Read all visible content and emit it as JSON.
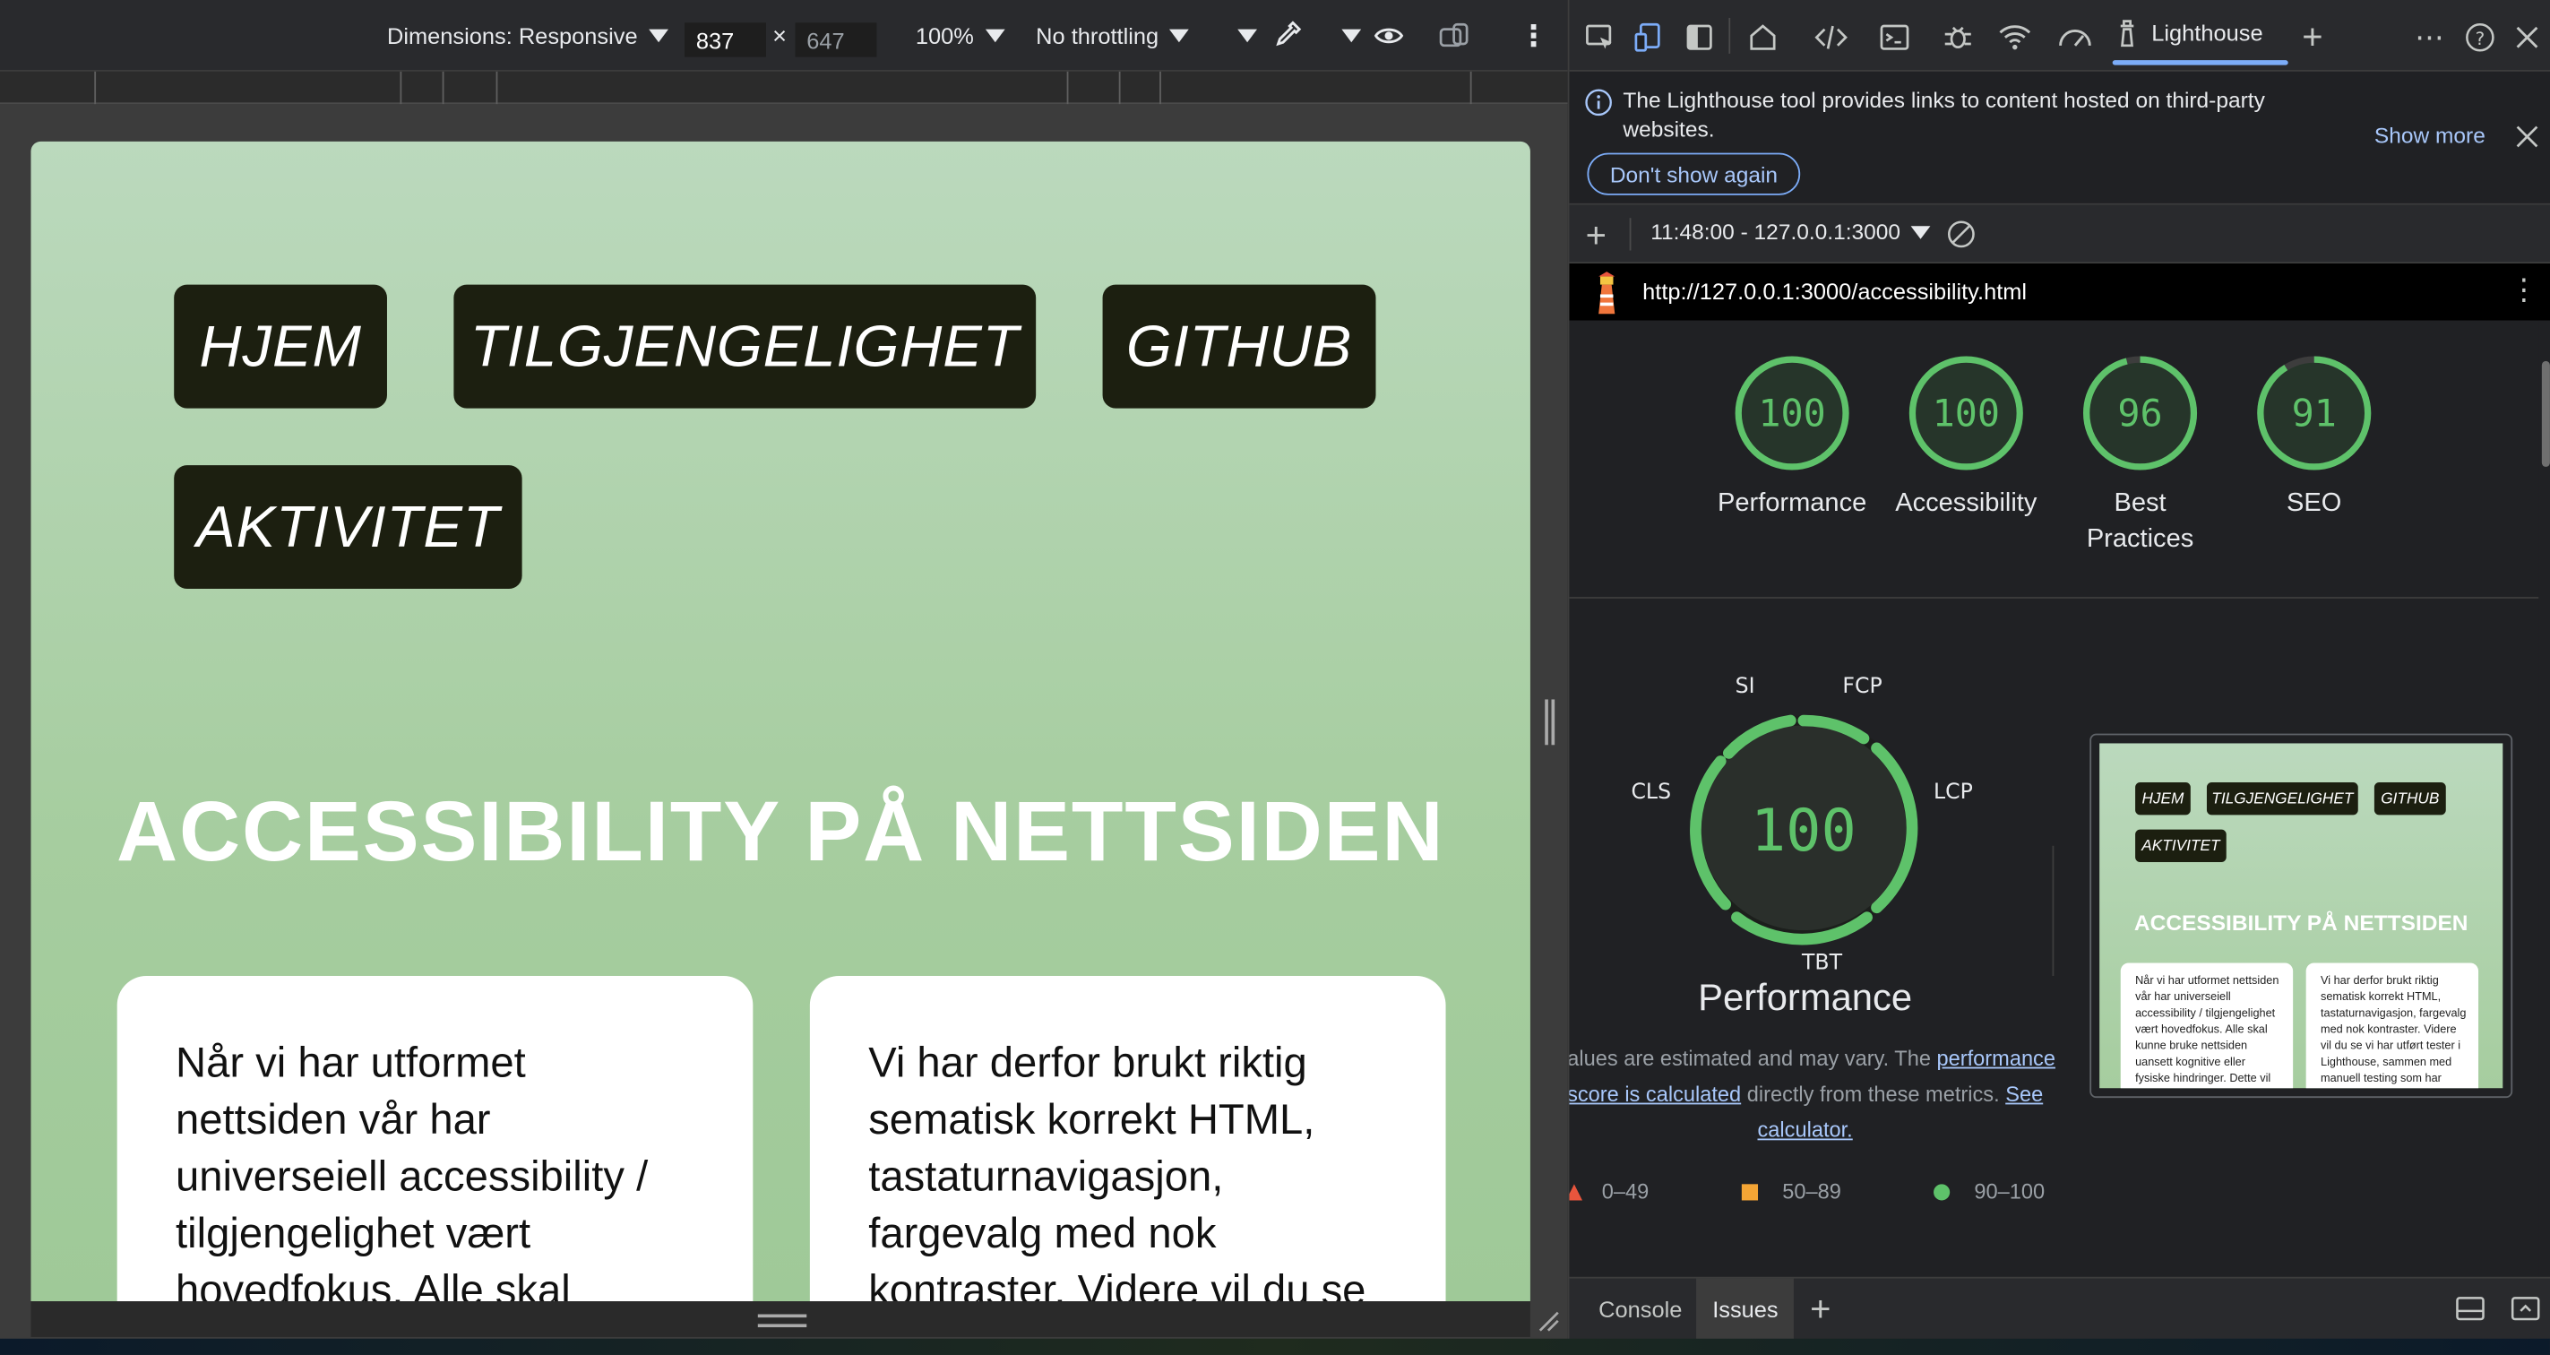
{
  "emulation_toolbar": {
    "dimensions_label": "Dimensions: Responsive",
    "width_value": "837",
    "times": "×",
    "height_value": "647",
    "zoom_label": "100%",
    "throttling_label": "No throttling"
  },
  "page": {
    "nav": [
      "HJEM",
      "TILGJENGELIGHET",
      "GITHUB",
      "AKTIVITET"
    ],
    "heading": "ACCESSIBILITY PÅ NETTSIDEN",
    "card1_text": "Når vi har utformet nettsiden vår har universeiell accessibility / tilgjengelighet vært hovedfokus. Alle skal",
    "card2_text": "Vi har derfor brukt riktig sematisk korrekt HTML, tastaturnavigasjon, fargevalg med nok kontraster. Videre vil du se"
  },
  "devtools": {
    "active_tab": "Lighthouse",
    "info_message": "The Lighthouse tool provides links to content hosted on third-party websites.",
    "show_more": "Show more",
    "dont_show_again": "Don't show again",
    "report_selector": "11:48:00 - 127.0.0.1:3000",
    "url": "http://127.0.0.1:3000/accessibility.html",
    "scores": [
      {
        "label": "Performance",
        "value": "100"
      },
      {
        "label": "Accessibility",
        "value": "100"
      },
      {
        "label": "Best Practices",
        "value": "96"
      },
      {
        "label": "SEO",
        "value": "91"
      }
    ],
    "perf_gauge": {
      "value": "100",
      "title": "Performance",
      "metrics": {
        "si": "SI",
        "fcp": "FCP",
        "cls": "CLS",
        "lcp": "LCP",
        "tbt": "TBT"
      }
    },
    "perf_note_pre": "Values are estimated and may vary. The ",
    "perf_note_link": "performance score is calculated",
    "perf_note_mid": " directly from these metrics. ",
    "perf_note_calc": "See calculator.",
    "legend": {
      "fail": "0–49",
      "average": "50–89",
      "pass": "90–100"
    },
    "thumbnail": {
      "nav": [
        "HJEM",
        "TILGJENGELIGHET",
        "GITHUB",
        "AKTIVITET"
      ],
      "heading": "ACCESSIBILITY PÅ NETTSIDEN",
      "card1": "Når vi har utformet nettsiden vår har universeiell accessibility / tilgjengelighet vært hovedfokus. Alle skal kunne bruke nettsiden uansett kognitive eller fysiske hindringer. Dette vil for eksempel være nedsatt",
      "card2": "Vi har derfor brukt riktig sematisk korrekt HTML, tastaturnavigasjon, fargevalg med nok kontraster. Videre vil du se vi har utført tester i Lighthouse, sammen med manuell testing som har"
    },
    "drawer_tabs": [
      "Console",
      "Issues"
    ]
  },
  "colors": {
    "score_pass": "#5ec26a",
    "score_average": "#f4a535",
    "score_fail": "#e8553d",
    "accent_blue": "#7cacf8",
    "page_green": "#a6cd9f",
    "nav_button": "#1c1f10"
  },
  "icons": [
    "inspect-icon",
    "device-toolbar-icon",
    "dock-icon",
    "home-icon",
    "elements-icon",
    "console-icon",
    "sources-icon",
    "network-icon",
    "performance-icon",
    "lighthouse-icon",
    "add-tab-icon",
    "more-icon",
    "help-icon",
    "close-icon",
    "info-icon",
    "eyedropper-icon",
    "eye-icon",
    "rotate-icon"
  ]
}
